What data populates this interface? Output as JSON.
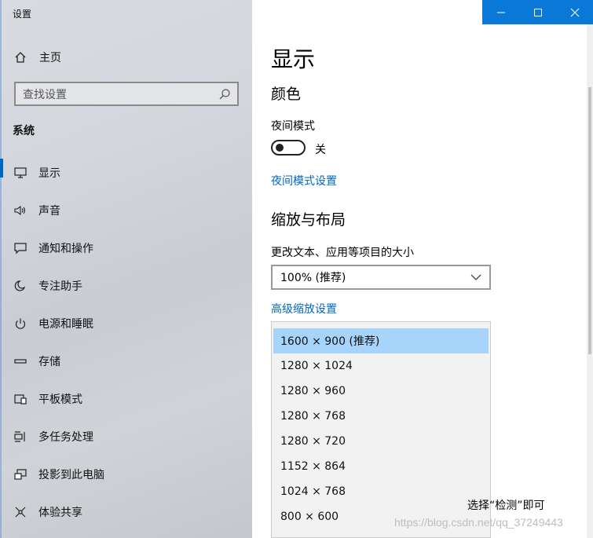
{
  "window": {
    "title": "设置"
  },
  "sidebar": {
    "home_label": "主页",
    "search_placeholder": "查找设置",
    "section_title": "系统",
    "items": [
      {
        "label": "显示",
        "icon": "monitor-icon",
        "active": true
      },
      {
        "label": "声音",
        "icon": "speaker-icon"
      },
      {
        "label": "通知和操作",
        "icon": "notification-icon"
      },
      {
        "label": "专注助手",
        "icon": "moon-icon"
      },
      {
        "label": "电源和睡眠",
        "icon": "power-icon"
      },
      {
        "label": "存储",
        "icon": "storage-icon"
      },
      {
        "label": "平板模式",
        "icon": "tablet-icon"
      },
      {
        "label": "多任务处理",
        "icon": "multitask-icon"
      },
      {
        "label": "投影到此电脑",
        "icon": "project-icon"
      },
      {
        "label": "体验共享",
        "icon": "share-icon"
      }
    ]
  },
  "main": {
    "title": "显示",
    "color_heading": "颜色",
    "night_mode_label": "夜间模式",
    "night_mode_state": "关",
    "night_mode_settings_link": "夜间模式设置",
    "scale_heading": "缩放与布局",
    "text_size_label": "更改文本、应用等项目的大小",
    "scale_value": "100% (推荐)",
    "advanced_scale_link": "高级缩放设置",
    "resolution_options": [
      "1600 × 900 (推荐)",
      "1280 × 1024",
      "1280 × 960",
      "1280 × 768",
      "1280 × 720",
      "1152 × 864",
      "1024 × 768",
      "800 × 600"
    ],
    "selected_resolution": "1600 × 900 (推荐)",
    "partial_text": "选择“检测”即可"
  },
  "watermark": "https://blog.csdn.net/qq_37249443",
  "colors": {
    "accent": "#0067c0",
    "titlebar": "#0a78d7",
    "selected_option": "#a6d4fa"
  }
}
